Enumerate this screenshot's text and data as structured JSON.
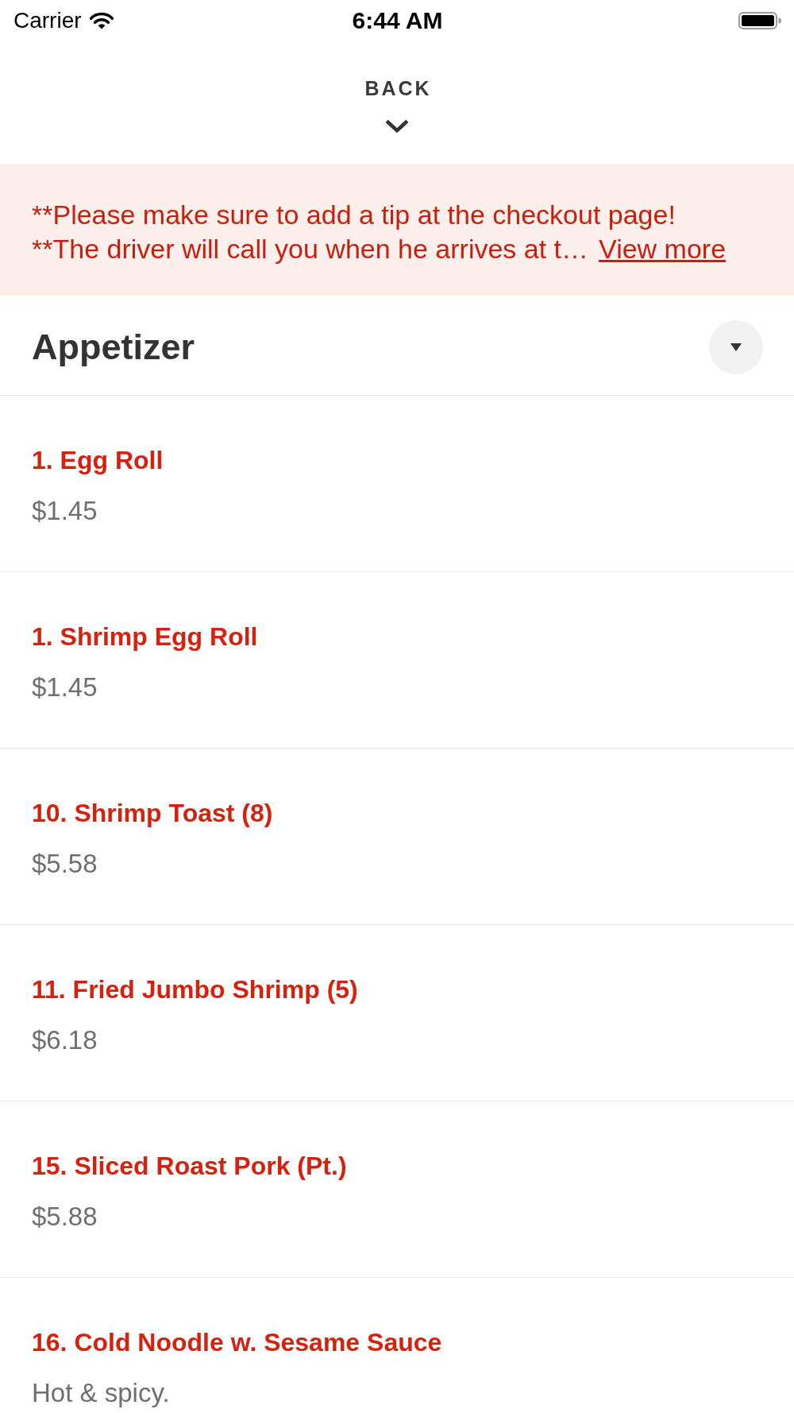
{
  "status_bar": {
    "carrier": "Carrier",
    "time": "6:44 AM"
  },
  "header": {
    "back": "BACK"
  },
  "notice": {
    "lines": [
      "**Please make sure to add a tip at the checkout page!",
      "**The driver will call you when he arrives at t…"
    ],
    "link": "View more"
  },
  "section": {
    "title": "Appetizer",
    "items": [
      {
        "name": "1. Egg Roll",
        "price": "$1.45"
      },
      {
        "name": "1. Shrimp Egg Roll",
        "price": "$1.45"
      },
      {
        "name": "10. Shrimp Toast (8)",
        "price": "$5.58"
      },
      {
        "name": "11. Fried Jumbo Shrimp (5)",
        "price": "$6.18"
      },
      {
        "name": "15. Sliced Roast Pork (Pt.)",
        "price": "$5.88"
      },
      {
        "name": "16. Cold Noodle w. Sesame Sauce",
        "description": "Hot & spicy."
      }
    ]
  }
}
